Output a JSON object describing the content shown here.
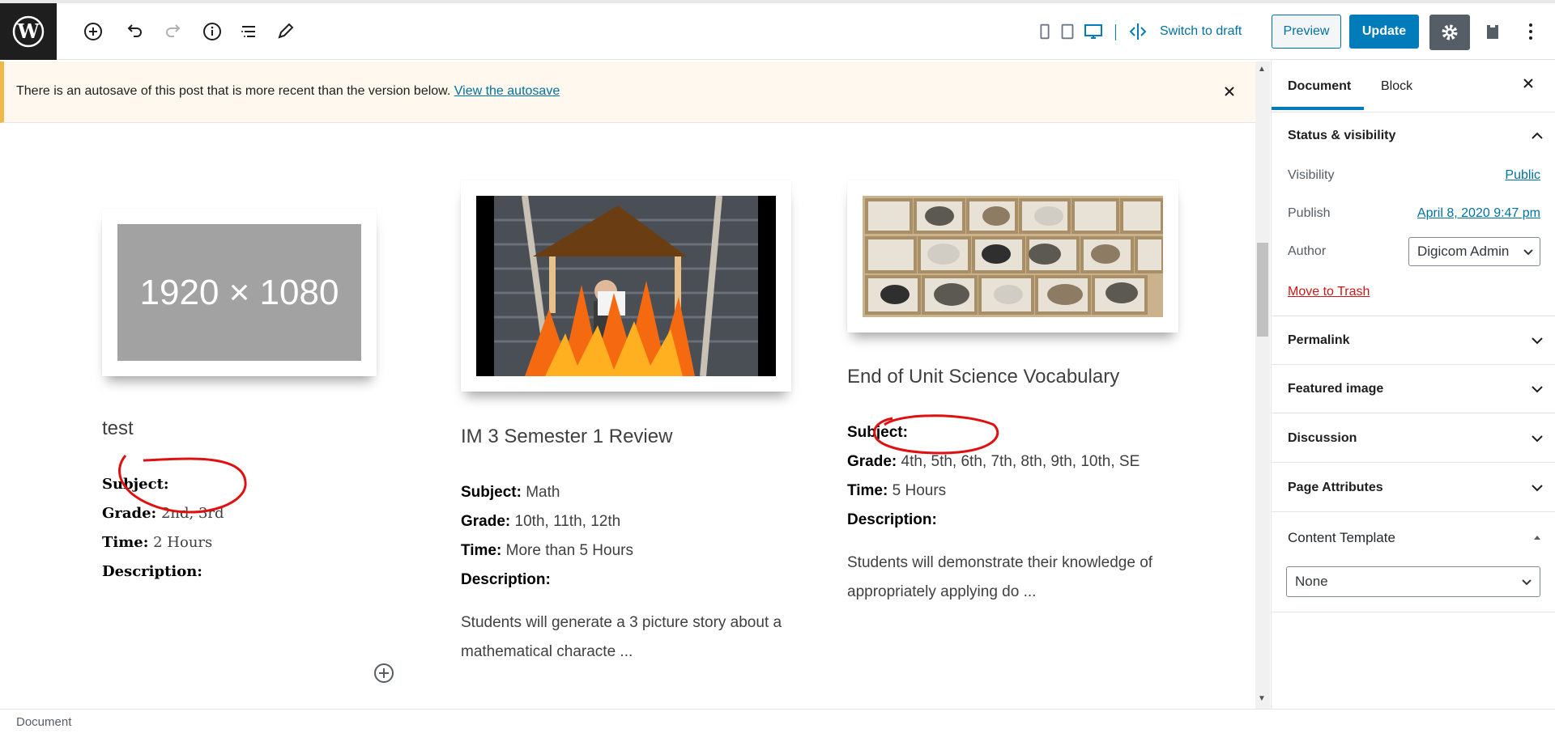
{
  "toolbar": {
    "switch_to_draft": "Switch to draft",
    "preview": "Preview",
    "update": "Update"
  },
  "notice": {
    "text": "There is an autosave of this post that is more recent than the version below. ",
    "link": "View the autosave"
  },
  "cards": [
    {
      "image_text": "1920 × 1080",
      "title": "test",
      "subject_label": "Subject:",
      "subject_value": "",
      "grade_label": "Grade:",
      "grade_value": "2nd, 3rd",
      "time_label": "Time:",
      "time_value": "2 Hours",
      "description_label": "Description:",
      "description": ""
    },
    {
      "title": "IM 3 Semester 1 Review",
      "subject_label": "Subject:",
      "subject_value": "Math",
      "grade_label": "Grade:",
      "grade_value": "10th, 11th, 12th",
      "time_label": "Time:",
      "time_value": "More than 5 Hours",
      "description_label": "Description:",
      "description": "Students will generate a 3 picture story about a mathematical characte ..."
    },
    {
      "title": "End of Unit Science Vocabulary",
      "subject_label": "Subject:",
      "subject_value": "",
      "grade_label": "Grade:",
      "grade_value": "4th, 5th, 6th, 7th, 8th, 9th, 10th, SE",
      "time_label": "Time:",
      "time_value": "5 Hours",
      "description_label": "Description:",
      "description": "Students will demonstrate their knowledge of appropriately applying do ..."
    }
  ],
  "sidebar": {
    "tabs": [
      "Document",
      "Block"
    ],
    "status_visibility": "Status & visibility",
    "visibility_label": "Visibility",
    "visibility_value": "Public",
    "publish_label": "Publish",
    "publish_value": "April 8, 2020 9:47 pm",
    "author_label": "Author",
    "author_value": "Digicom Admin",
    "move_to_trash": "Move to Trash",
    "panels": [
      "Permalink",
      "Featured image",
      "Discussion",
      "Page Attributes"
    ],
    "content_template": "Content Template",
    "template_value": "None"
  },
  "footer": {
    "breadcrumb": "Document"
  },
  "colors": {
    "accent": "#007cba",
    "link": "#0071a1",
    "notice_border": "#f0b849",
    "annotation": "#e01010"
  }
}
